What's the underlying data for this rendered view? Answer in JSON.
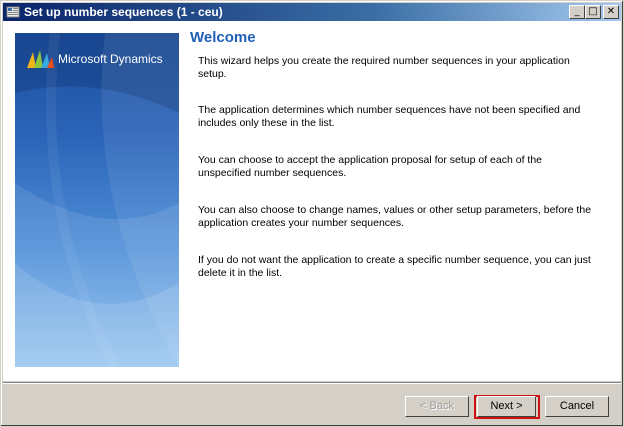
{
  "window": {
    "title": "Set up number sequences (1 - ceu)",
    "controls": {
      "minimize": "_",
      "maximize": "□",
      "close": "✕"
    }
  },
  "side_panel": {
    "logo_text": "Microsoft Dynamics"
  },
  "main": {
    "heading": "Welcome",
    "paragraphs": [
      "This wizard helps you create the required number sequences in your application setup.",
      "The application determines which number sequences have not been specified and includes only these in the list.",
      "You can choose to accept the application proposal for setup of each of the unspecified number sequences.",
      "You can also choose to change names, values or other setup parameters, before the application creates your number sequences.",
      "If you do not want the application to create a specific number sequence, you can just delete it in the list."
    ]
  },
  "buttons": {
    "back": "< Back",
    "next": "Next >",
    "cancel": "Cancel"
  },
  "colors": {
    "heading": "#1f5fb6",
    "highlight_border": "#d01010",
    "titlebar_start": "#0a246a",
    "titlebar_end": "#a6caf0"
  }
}
